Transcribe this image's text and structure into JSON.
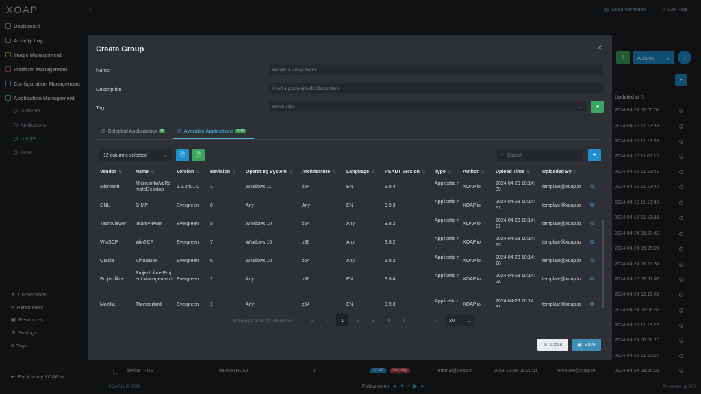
{
  "app": {
    "logo": "XOAP",
    "documentation": "Documentation",
    "get_help": "Get Help"
  },
  "sidebar": {
    "items": [
      {
        "label": "Dashboard"
      },
      {
        "label": "Activity Log"
      },
      {
        "label": "Image Management"
      },
      {
        "label": "Platform Management"
      },
      {
        "label": "Configuration Management"
      },
      {
        "label": "Application Management"
      }
    ],
    "subitems": [
      {
        "label": "Overview"
      },
      {
        "label": "Applications"
      },
      {
        "label": "Groups"
      },
      {
        "label": "Roles"
      }
    ],
    "bottom": [
      {
        "label": "Connections"
      },
      {
        "label": "Parameters"
      },
      {
        "label": "Resources"
      },
      {
        "label": "Settings"
      },
      {
        "label": "Tags"
      }
    ],
    "back_link": "Back to my.XOAP.io"
  },
  "background": {
    "actions_label": "Actions",
    "updated_at_header": "Updated at",
    "timestamps": [
      "2024-04-24 06:05:02",
      "2024-04-15 11:13:38",
      "2024-04-15 11:13:38",
      "2024-04-15 11:06:10",
      "2024-04-15 11:13:41",
      "2024-04-15 11:13:40",
      "2024-04-15 11:13:45",
      "2024-04-15 11:13:38",
      "2024-04-24 06:22:43",
      "2024-04-24 06:26:24",
      "2024-04-24 06:27:34",
      "2024-04-16 08:51:48",
      "2024-04-24 12:19:41",
      "2024-04-24 06:06:32",
      "2024-04-15 11:13:22",
      "2024-04-24 06:06:10",
      "2024-04-15 11:11:54",
      "2024-04-24 06:25:21"
    ],
    "last_row": {
      "name": "deviceTRUST",
      "vendor": "deviceTRUST",
      "count": "2",
      "tag1": "XOAP",
      "tag2": "Security",
      "author": "internal@xoap.io",
      "upload": "2023-12-15 09:20:11",
      "uploader": "template@xoap.io"
    },
    "footer_left": "XOAP.io © 2024",
    "footer_follow": "Follow us on",
    "footer_right": "Powered by RIS"
  },
  "modal": {
    "title": "Create Group",
    "name_label": "Name",
    "name_required": "*",
    "name_placeholder": "Specify a Group Name",
    "description_label": "Description",
    "description_placeholder": "Insert a group-specific Description",
    "tag_label": "Tag",
    "tag_placeholder": "Select Tags",
    "tabs": [
      {
        "label": "Selected Applications",
        "badge": "0"
      },
      {
        "label": "Available Applications",
        "badge": "105"
      }
    ],
    "columns_selected": "12 columns selected",
    "search_placeholder": "Search",
    "columns": [
      "Vendor",
      "Name",
      "Version",
      "Revision",
      "Operating System",
      "Architecture",
      "Language",
      "PSADT Version",
      "Type",
      "Author",
      "Upload Time",
      "Uploaded By"
    ],
    "rows": [
      [
        "Microsoft",
        "MicrosoftWvdRe moteDesktop",
        "1.2.3401.0",
        "1",
        "Windows 11",
        "x64",
        "EN",
        "3.8.4",
        "Applicatio n",
        "XOAP.io",
        "2024-04-23 10:14: 39",
        "template@xoap.io"
      ],
      [
        "GNU",
        "GIMP",
        "Evergreen",
        "6",
        "Any",
        "Any",
        "EN",
        "3.9.3",
        "Applicatio n",
        "XOAP.io",
        "2024-04-23 10:14: 51",
        "template@xoap.io"
      ],
      [
        "TeamViewer",
        "TeamViewer",
        "Evergreen",
        "5",
        "Windows 10",
        "x64",
        "Any",
        "3.8.2",
        "Applicatio n",
        "XOAP.io",
        "2024-04-23 10:14: 21",
        "template@xoap.io"
      ],
      [
        "WinSCP",
        "WinSCP",
        "Evergreen",
        "7",
        "Windows 10",
        "x86",
        "Any",
        "3.8.2",
        "Applicatio n",
        "XOAP.io",
        "2024-04-23 10:14: 15",
        "template@xoap.io"
      ],
      [
        "Oracle",
        "VirtualBox",
        "Evergreen",
        "6",
        "Windows 10",
        "x64",
        "Any",
        "3.8.2",
        "Applicatio n",
        "XOAP.io",
        "2024-04-23 10:14: 28",
        "template@xoap.io"
      ],
      [
        "Projectlibre",
        "ProjectLibre-Proj ect Managemen t",
        "Evergreen",
        "1",
        "Any",
        "x86",
        "EN",
        "3.8.4",
        "Applicatio n",
        "XOAP.io",
        "2024-04-23 10:14: 24",
        "template@xoap.io"
      ],
      [
        "Mozilla",
        "Thunderbird",
        "Evergreen",
        "1",
        "Any",
        "x64",
        "EN",
        "3.9.3",
        "Applicatio n",
        "XOAP.io",
        "2024-04-23 10:14: 31",
        "template@xoap.io"
      ]
    ],
    "pagination": {
      "info": "Showing 1 to 20 of 105 entries",
      "first": "«",
      "prev": "‹",
      "pages": [
        "1",
        "2",
        "3",
        "4",
        "5"
      ],
      "next": "›",
      "last": "»",
      "page_size": "20"
    },
    "close_label": "Close",
    "save_label": "Save"
  },
  "colors": {
    "accent_blue": "#1f8fd1",
    "accent_green": "#3aa55f",
    "active_tab": "#4db7e6"
  }
}
